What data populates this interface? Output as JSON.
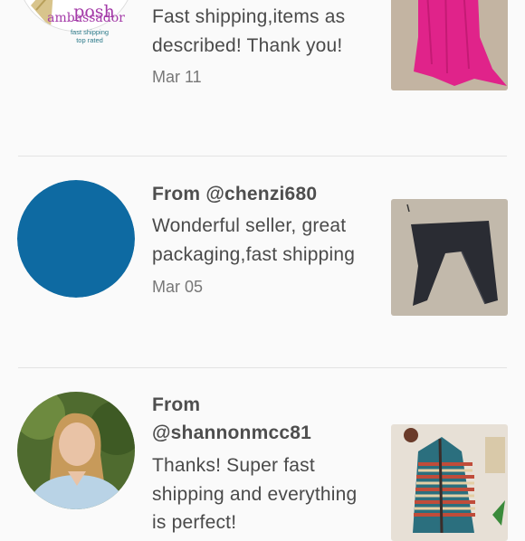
{
  "reviews": [
    {
      "from": "",
      "comment": "Fast shipping,items as described! Thank you!",
      "date": "Mar 11",
      "avatar_badge": {
        "line1": "posh",
        "line2": "ambassador",
        "line3": "fast shipping",
        "line4": "top rated"
      },
      "thumb_icon": "pink-dress-icon"
    },
    {
      "from": "From @chenzi680",
      "comment": "Wonderful seller, great packaging,fast shipping",
      "date": "Mar 05",
      "avatar_color": "#0e6aa2",
      "thumb_icon": "black-leggings-icon"
    },
    {
      "from": "From @shannonmcc81",
      "comment": "Thanks! Super fast shipping and everything is perfect!",
      "date": "",
      "avatar_icon": "woman-portrait-icon",
      "thumb_icon": "striped-cardigan-icon"
    }
  ]
}
